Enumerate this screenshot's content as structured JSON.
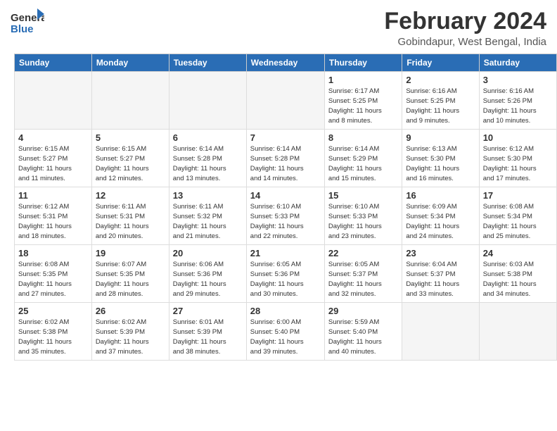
{
  "header": {
    "logo_general": "General",
    "logo_blue": "Blue",
    "month_title": "February 2024",
    "location": "Gobindapur, West Bengal, India"
  },
  "calendar": {
    "days_of_week": [
      "Sunday",
      "Monday",
      "Tuesday",
      "Wednesday",
      "Thursday",
      "Friday",
      "Saturday"
    ],
    "weeks": [
      [
        {
          "num": "",
          "info": ""
        },
        {
          "num": "",
          "info": ""
        },
        {
          "num": "",
          "info": ""
        },
        {
          "num": "",
          "info": ""
        },
        {
          "num": "1",
          "info": "Sunrise: 6:17 AM\nSunset: 5:25 PM\nDaylight: 11 hours\nand 8 minutes."
        },
        {
          "num": "2",
          "info": "Sunrise: 6:16 AM\nSunset: 5:25 PM\nDaylight: 11 hours\nand 9 minutes."
        },
        {
          "num": "3",
          "info": "Sunrise: 6:16 AM\nSunset: 5:26 PM\nDaylight: 11 hours\nand 10 minutes."
        }
      ],
      [
        {
          "num": "4",
          "info": "Sunrise: 6:15 AM\nSunset: 5:27 PM\nDaylight: 11 hours\nand 11 minutes."
        },
        {
          "num": "5",
          "info": "Sunrise: 6:15 AM\nSunset: 5:27 PM\nDaylight: 11 hours\nand 12 minutes."
        },
        {
          "num": "6",
          "info": "Sunrise: 6:14 AM\nSunset: 5:28 PM\nDaylight: 11 hours\nand 13 minutes."
        },
        {
          "num": "7",
          "info": "Sunrise: 6:14 AM\nSunset: 5:28 PM\nDaylight: 11 hours\nand 14 minutes."
        },
        {
          "num": "8",
          "info": "Sunrise: 6:14 AM\nSunset: 5:29 PM\nDaylight: 11 hours\nand 15 minutes."
        },
        {
          "num": "9",
          "info": "Sunrise: 6:13 AM\nSunset: 5:30 PM\nDaylight: 11 hours\nand 16 minutes."
        },
        {
          "num": "10",
          "info": "Sunrise: 6:12 AM\nSunset: 5:30 PM\nDaylight: 11 hours\nand 17 minutes."
        }
      ],
      [
        {
          "num": "11",
          "info": "Sunrise: 6:12 AM\nSunset: 5:31 PM\nDaylight: 11 hours\nand 18 minutes."
        },
        {
          "num": "12",
          "info": "Sunrise: 6:11 AM\nSunset: 5:31 PM\nDaylight: 11 hours\nand 20 minutes."
        },
        {
          "num": "13",
          "info": "Sunrise: 6:11 AM\nSunset: 5:32 PM\nDaylight: 11 hours\nand 21 minutes."
        },
        {
          "num": "14",
          "info": "Sunrise: 6:10 AM\nSunset: 5:33 PM\nDaylight: 11 hours\nand 22 minutes."
        },
        {
          "num": "15",
          "info": "Sunrise: 6:10 AM\nSunset: 5:33 PM\nDaylight: 11 hours\nand 23 minutes."
        },
        {
          "num": "16",
          "info": "Sunrise: 6:09 AM\nSunset: 5:34 PM\nDaylight: 11 hours\nand 24 minutes."
        },
        {
          "num": "17",
          "info": "Sunrise: 6:08 AM\nSunset: 5:34 PM\nDaylight: 11 hours\nand 25 minutes."
        }
      ],
      [
        {
          "num": "18",
          "info": "Sunrise: 6:08 AM\nSunset: 5:35 PM\nDaylight: 11 hours\nand 27 minutes."
        },
        {
          "num": "19",
          "info": "Sunrise: 6:07 AM\nSunset: 5:35 PM\nDaylight: 11 hours\nand 28 minutes."
        },
        {
          "num": "20",
          "info": "Sunrise: 6:06 AM\nSunset: 5:36 PM\nDaylight: 11 hours\nand 29 minutes."
        },
        {
          "num": "21",
          "info": "Sunrise: 6:05 AM\nSunset: 5:36 PM\nDaylight: 11 hours\nand 30 minutes."
        },
        {
          "num": "22",
          "info": "Sunrise: 6:05 AM\nSunset: 5:37 PM\nDaylight: 11 hours\nand 32 minutes."
        },
        {
          "num": "23",
          "info": "Sunrise: 6:04 AM\nSunset: 5:37 PM\nDaylight: 11 hours\nand 33 minutes."
        },
        {
          "num": "24",
          "info": "Sunrise: 6:03 AM\nSunset: 5:38 PM\nDaylight: 11 hours\nand 34 minutes."
        }
      ],
      [
        {
          "num": "25",
          "info": "Sunrise: 6:02 AM\nSunset: 5:38 PM\nDaylight: 11 hours\nand 35 minutes."
        },
        {
          "num": "26",
          "info": "Sunrise: 6:02 AM\nSunset: 5:39 PM\nDaylight: 11 hours\nand 37 minutes."
        },
        {
          "num": "27",
          "info": "Sunrise: 6:01 AM\nSunset: 5:39 PM\nDaylight: 11 hours\nand 38 minutes."
        },
        {
          "num": "28",
          "info": "Sunrise: 6:00 AM\nSunset: 5:40 PM\nDaylight: 11 hours\nand 39 minutes."
        },
        {
          "num": "29",
          "info": "Sunrise: 5:59 AM\nSunset: 5:40 PM\nDaylight: 11 hours\nand 40 minutes."
        },
        {
          "num": "",
          "info": ""
        },
        {
          "num": "",
          "info": ""
        }
      ]
    ]
  }
}
